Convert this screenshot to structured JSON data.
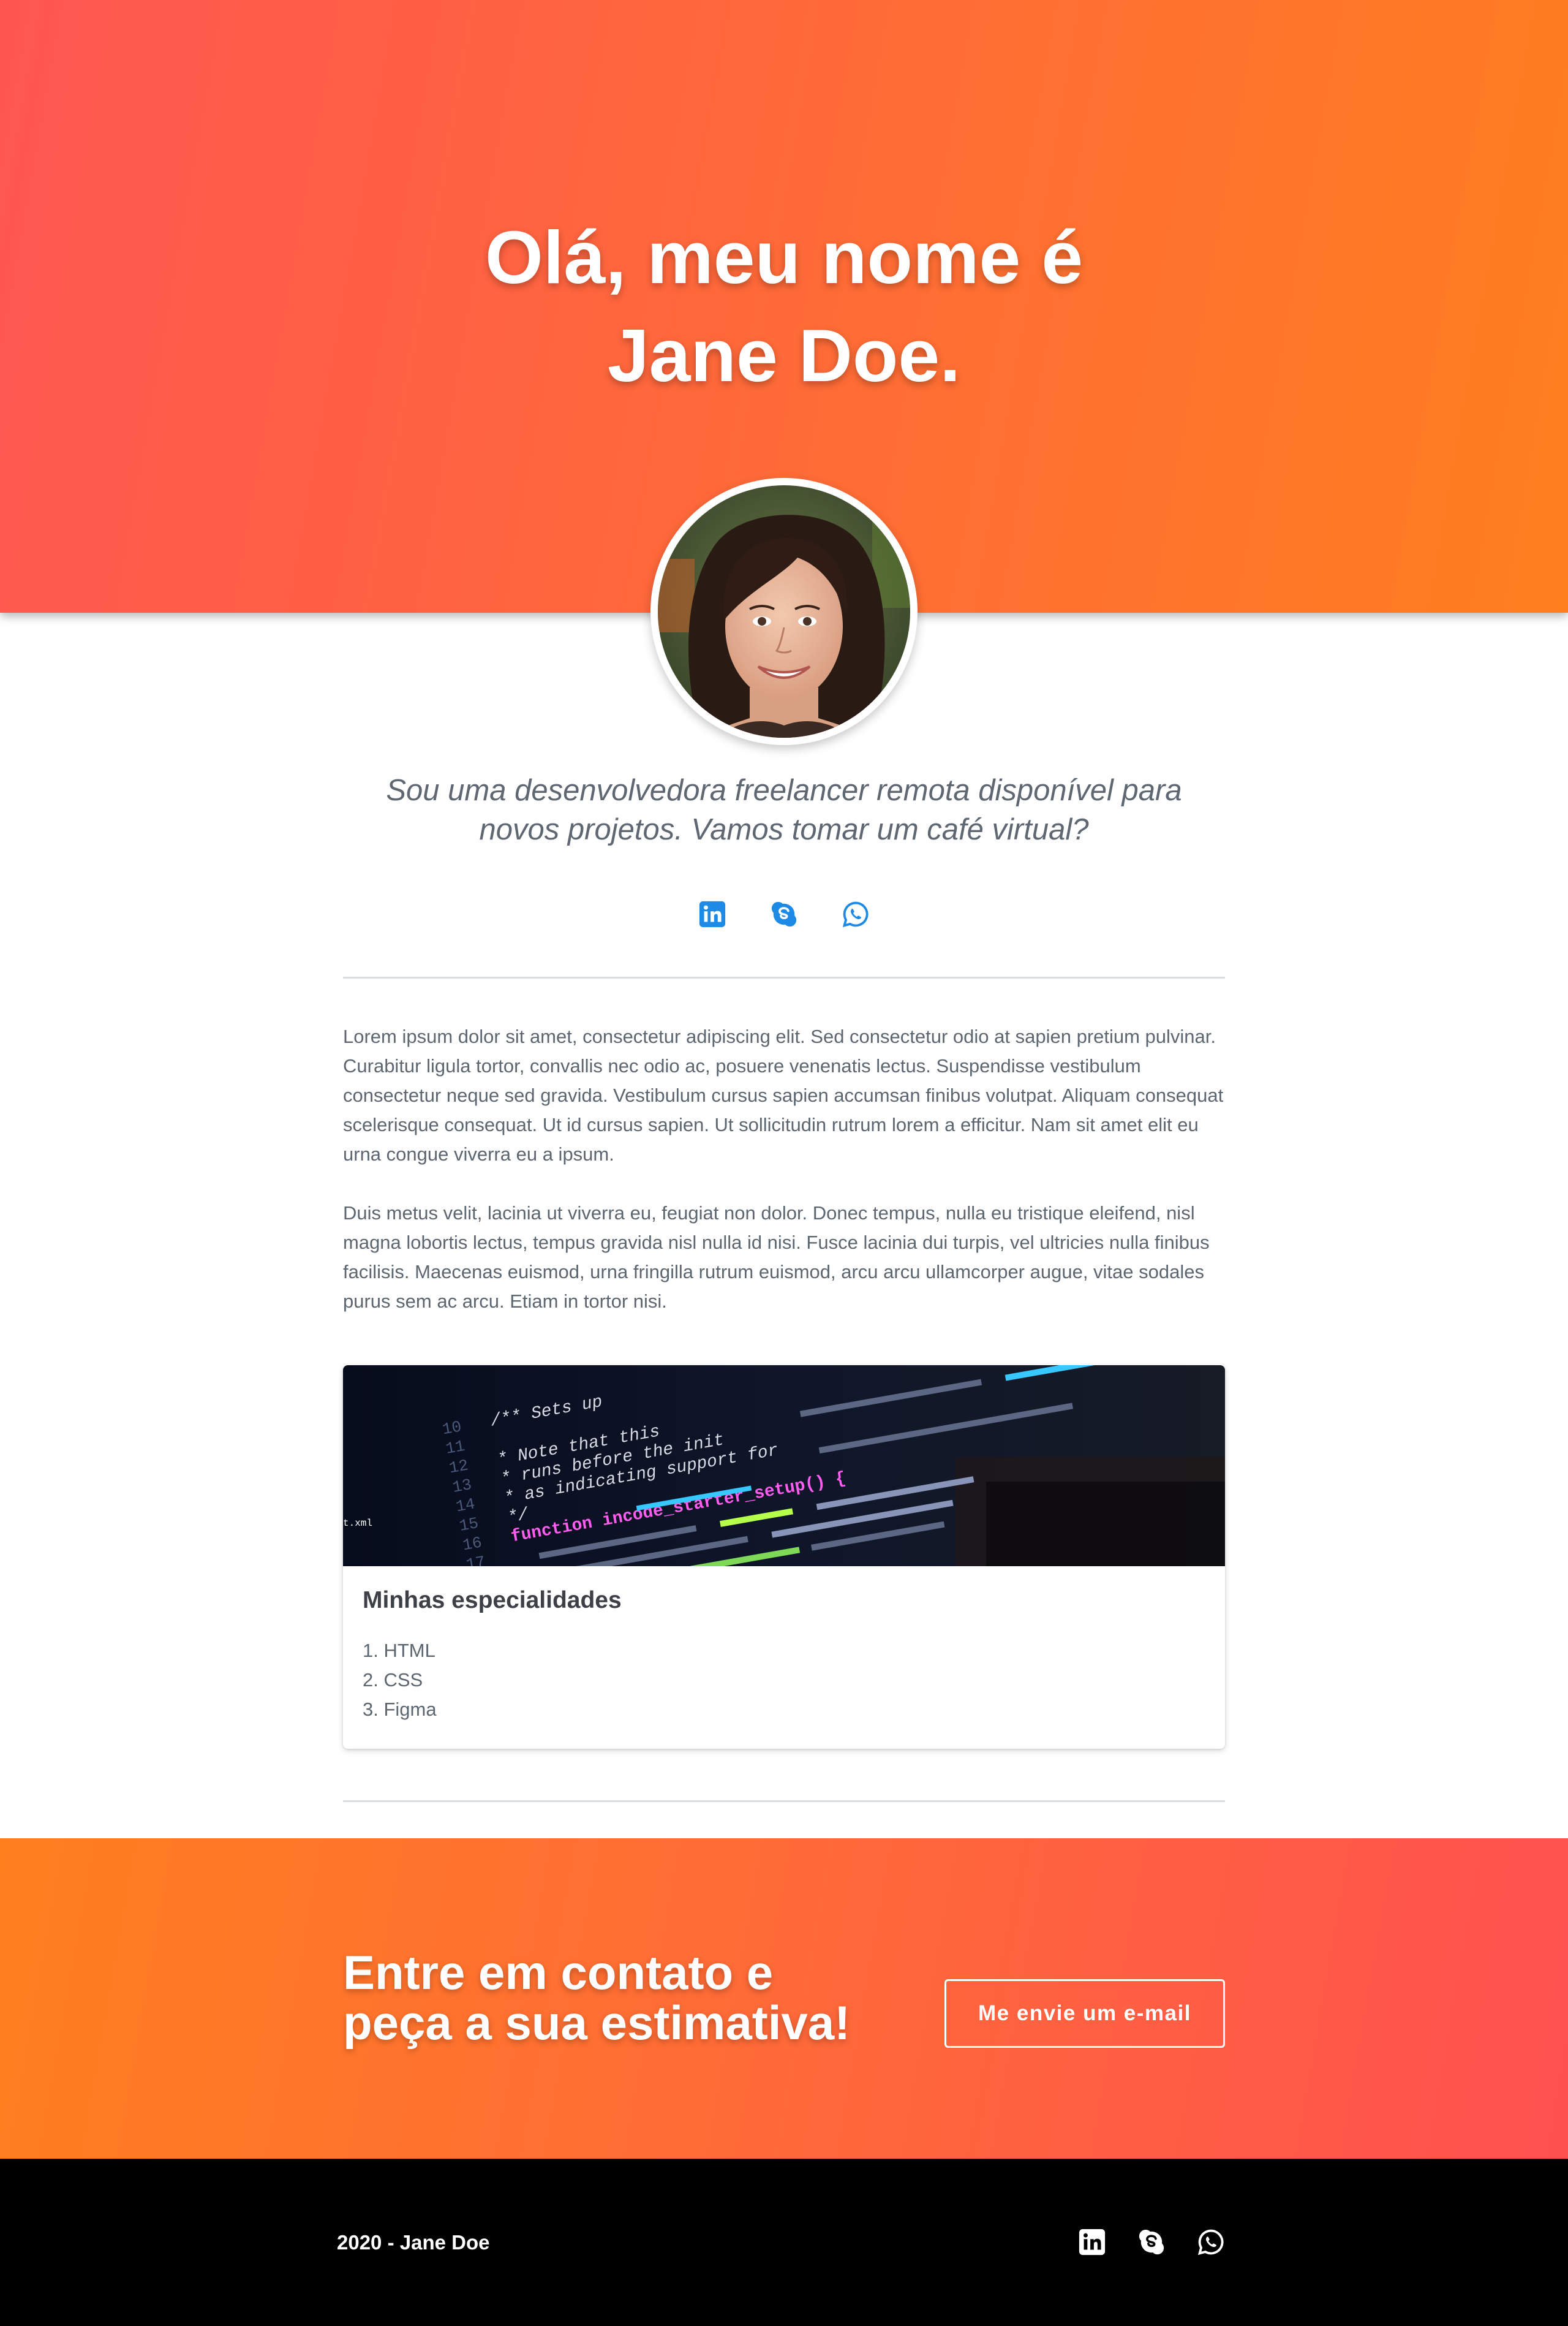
{
  "hero": {
    "title_line1": "Olá, meu nome é",
    "title_line2": "Jane Doe."
  },
  "intro": {
    "tagline": "Sou uma desenvolvedora freelancer remota disponível para novos projetos. Vamos tomar um café virtual?",
    "social": [
      {
        "icon": "linkedin-icon"
      },
      {
        "icon": "skype-icon"
      },
      {
        "icon": "whatsapp-icon"
      }
    ]
  },
  "about": {
    "paragraphs": [
      "Lorem ipsum dolor sit amet, consectetur adipiscing elit. Sed consectetur odio at sapien pretium pulvinar. Curabitur ligula tortor, convallis nec odio ac, posuere venenatis lectus. Suspendisse vestibulum consectetur neque sed gravida. Vestibulum cursus sapien accumsan finibus volutpat. Aliquam consequat scelerisque consequat. Ut id cursus sapien. Ut sollicitudin rutrum lorem a efficitur. Nam sit amet elit eu urna congue viverra eu a ipsum.",
      "Duis metus velit, lacinia ut viverra eu, feugiat non dolor. Donec tempus, nulla eu tristique eleifend, nisl magna lobortis lectus, tempus gravida nisl nulla id nisi. Fusce lacinia dui turpis, vel ultricies nulla finibus facilisis. Maecenas euismod, urna fringilla rutrum euismod, arcu arcu ullamcorper augue, vitae sodales purus sem ac arcu. Etiam in tortor nisi."
    ]
  },
  "skills": {
    "title": "Minhas especialidades",
    "items": [
      "1. HTML",
      "2. CSS",
      "3. Figma"
    ],
    "code_lines": [
      "/** Sets up",
      "* Note that this",
      "* runs before the init",
      "* as indicating support for",
      "*/",
      "function incode_starter_setup() {",
      "t.xml"
    ]
  },
  "cta": {
    "heading_line1": "Entre em contato e",
    "heading_line2": "peça a sua estimativa!",
    "button_label": "Me envie um e-mail"
  },
  "footer": {
    "copyright": "2020 - Jane Doe"
  },
  "colors": {
    "accent_blue": "#1d8ae6",
    "gradient_red": "#ff5652",
    "gradient_orange": "#ff7f1f",
    "footer_bg": "#000000"
  }
}
